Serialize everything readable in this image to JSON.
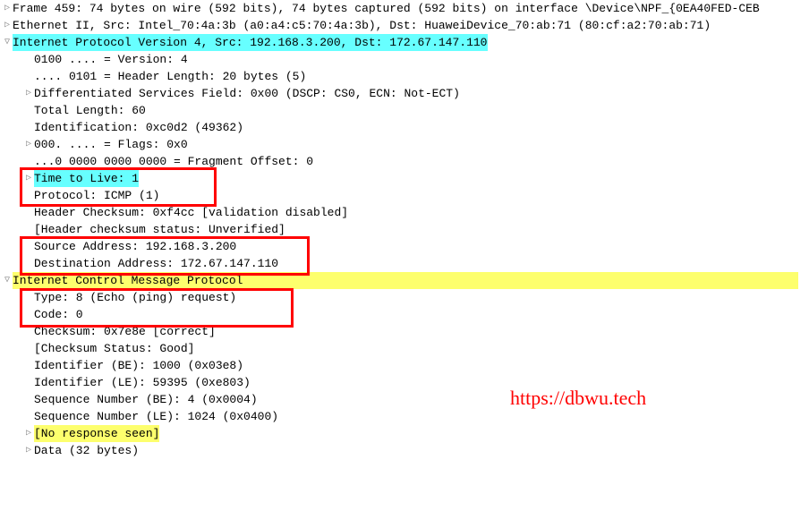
{
  "frame": {
    "summary": "Frame 459: 74 bytes on wire (592 bits), 74 bytes captured (592 bits) on interface \\Device\\NPF_{0EA40FED-CEB"
  },
  "ethernet": {
    "summary": "Ethernet II, Src: Intel_70:4a:3b (a0:a4:c5:70:4a:3b), Dst: HuaweiDevice_70:ab:71 (80:cf:a2:70:ab:71)"
  },
  "ip": {
    "summary": "Internet Protocol Version 4, Src: 192.168.3.200, Dst: 172.67.147.110",
    "version": "0100 .... = Version: 4",
    "header_len": ".... 0101 = Header Length: 20 bytes (5)",
    "dsfield": "Differentiated Services Field: 0x00 (DSCP: CS0, ECN: Not-ECT)",
    "total_len": "Total Length: 60",
    "identification": "Identification: 0xc0d2 (49362)",
    "flags": "000. .... = Flags: 0x0",
    "frag_offset": "...0 0000 0000 0000 = Fragment Offset: 0",
    "ttl": "Time to Live: 1",
    "protocol": "Protocol: ICMP (1)",
    "checksum": "Header Checksum: 0xf4cc [validation disabled]",
    "checksum_status": "[Header checksum status: Unverified]",
    "src_addr": "Source Address: 192.168.3.200",
    "dst_addr": "Destination Address: 172.67.147.110"
  },
  "icmp": {
    "summary": "Internet Control Message Protocol",
    "type": "Type: 8 (Echo (ping) request)",
    "code": "Code: 0",
    "checksum": "Checksum: 0x7e8e [correct]",
    "checksum_status": "[Checksum Status: Good]",
    "ident_be": "Identifier (BE): 1000 (0x03e8)",
    "ident_le": "Identifier (LE): 59395 (0xe803)",
    "seq_be": "Sequence Number (BE): 4 (0x0004)",
    "seq_le": "Sequence Number (LE): 1024 (0x0400)",
    "no_response": "[No response seen]",
    "data": "Data (32 bytes)"
  },
  "watermark": "https://dbwu.tech"
}
